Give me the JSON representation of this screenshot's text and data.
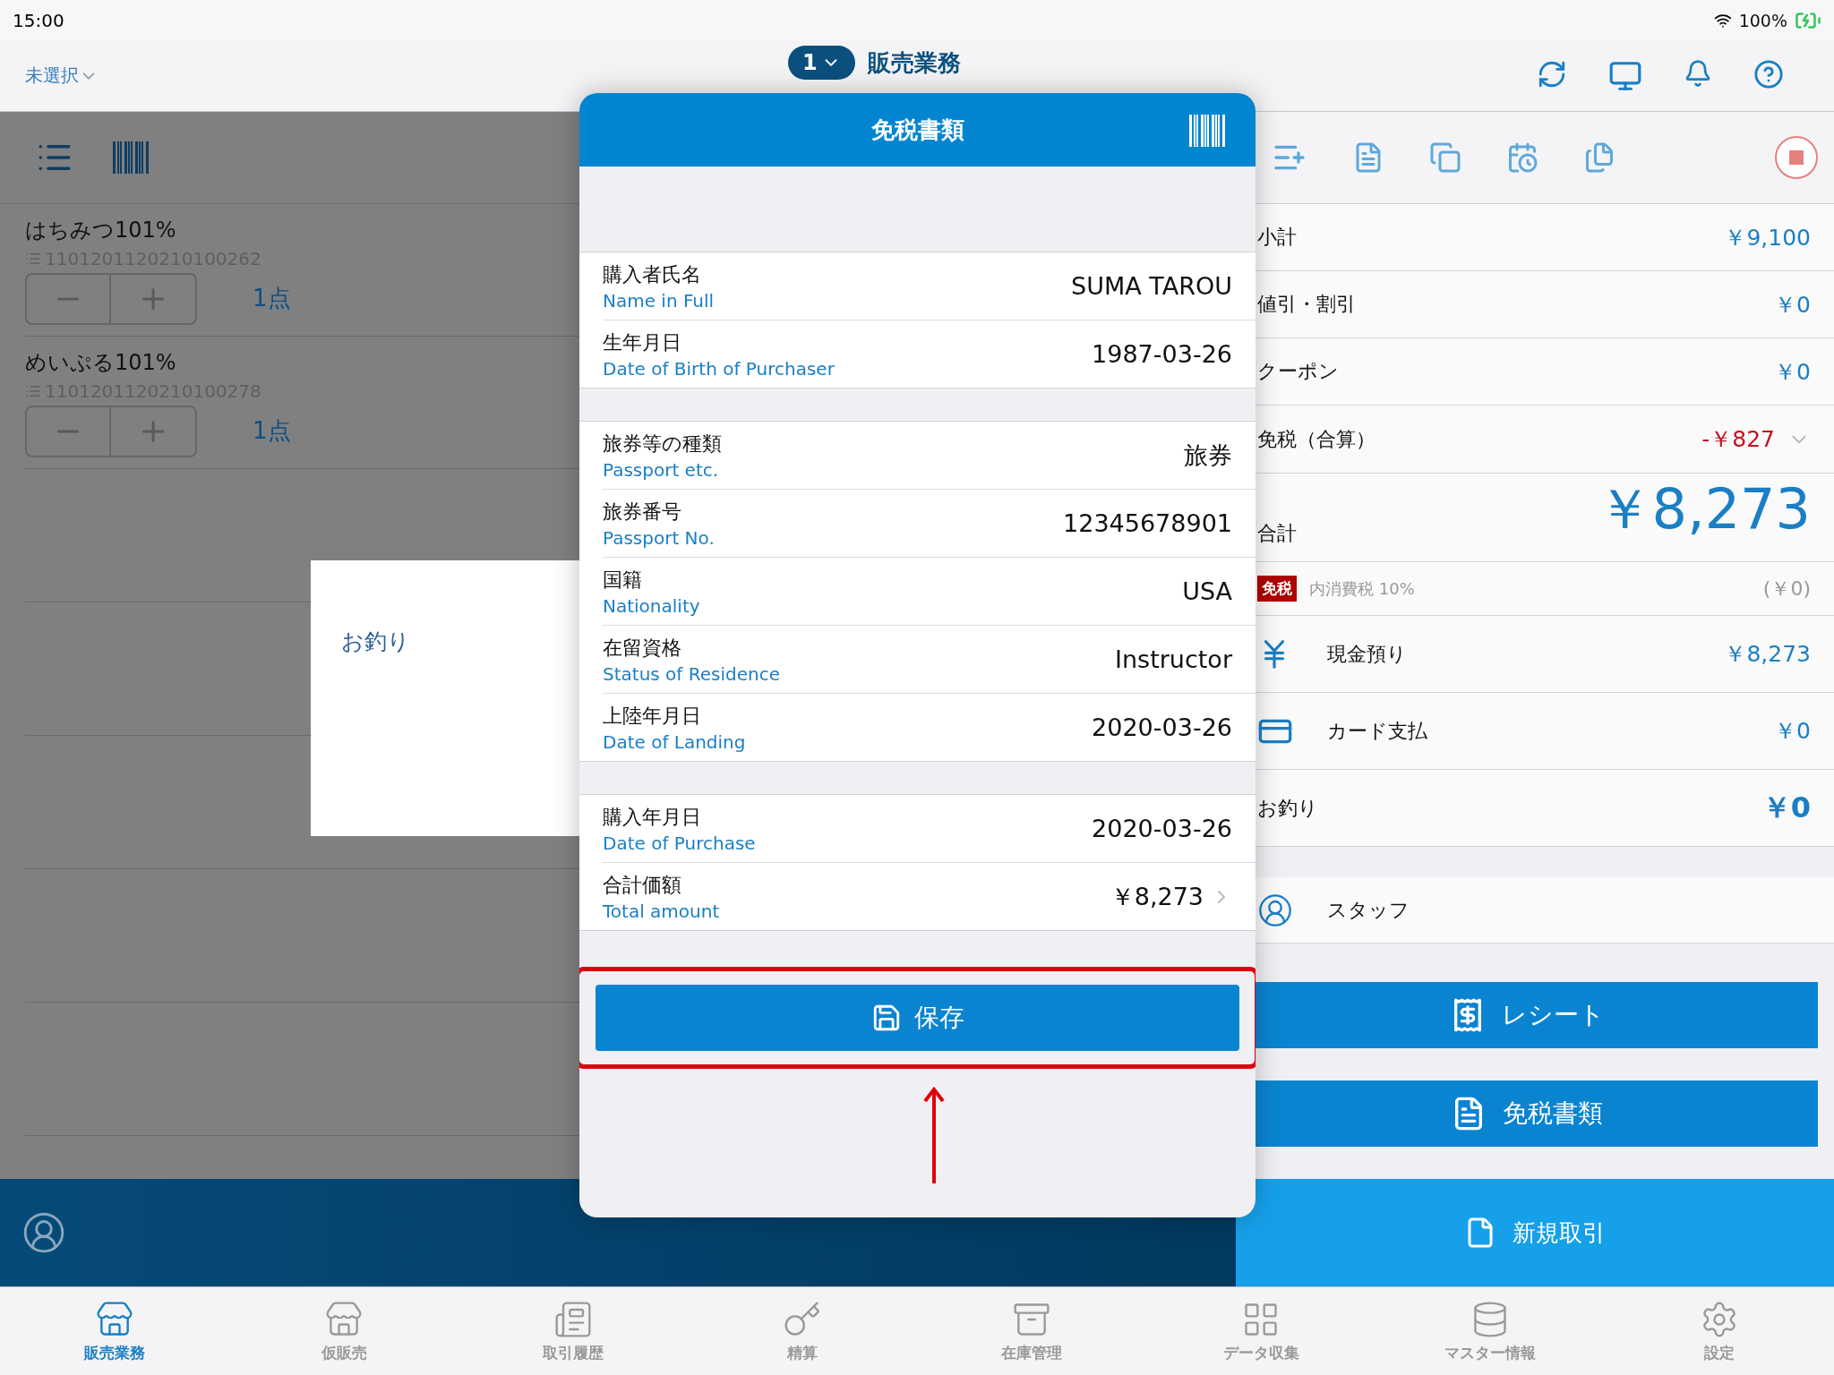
{
  "status_bar": {
    "time": "15:00",
    "battery": "100%"
  },
  "nav_bar": {
    "store": "未選択",
    "register": "1",
    "title": "販売業務"
  },
  "cart_items": [
    {
      "name": "はちみつ101%",
      "code": "1101201120210100262",
      "quantity": "1点"
    },
    {
      "name": "めいぷる101%",
      "code": "1101201120210100278",
      "quantity": "1点"
    }
  ],
  "change_popover": {
    "label": "お釣り"
  },
  "dialog": {
    "title": "免税書類",
    "sections": [
      [
        {
          "label": "購入者氏名",
          "label_en": "Name in Full",
          "value": "SUMA TAROU",
          "disclosure": false
        },
        {
          "label": "生年月日",
          "label_en": "Date of Birth of Purchaser",
          "value": "1987-03-26",
          "disclosure": false
        }
      ],
      [
        {
          "label": "旅券等の種類",
          "label_en": "Passport etc.",
          "value": "旅券",
          "disclosure": false
        },
        {
          "label": "旅券番号",
          "label_en": "Passport No.",
          "value": "12345678901",
          "disclosure": false
        },
        {
          "label": "国籍",
          "label_en": "Nationality",
          "value": "USA",
          "disclosure": false
        },
        {
          "label": "在留資格",
          "label_en": "Status of Residence",
          "value": "Instructor",
          "disclosure": false
        },
        {
          "label": "上陸年月日",
          "label_en": "Date of Landing",
          "value": "2020-03-26",
          "disclosure": false
        }
      ],
      [
        {
          "label": "購入年月日",
          "label_en": "Date of Purchase",
          "value": "2020-03-26",
          "disclosure": false
        },
        {
          "label": "合計価額",
          "label_en": "Total amount",
          "value": "￥8,273",
          "disclosure": true
        }
      ]
    ],
    "save_button": "保存"
  },
  "summary": [
    {
      "kind": "amount",
      "label": "小計",
      "value": "￥9,100"
    },
    {
      "kind": "amount",
      "label": "値引・割引",
      "value": "￥0"
    },
    {
      "kind": "amount",
      "label": "クーポン",
      "value": "￥0"
    },
    {
      "kind": "exemption",
      "label": "免税（合算）",
      "value": "-￥827"
    },
    {
      "kind": "total",
      "label": "合計",
      "value": "￥8,273"
    },
    {
      "kind": "tax",
      "badge": "免税",
      "label": "内消費税 10%",
      "value": "(￥0)"
    },
    {
      "kind": "cash",
      "label": "現金預り",
      "value": "￥8,273"
    },
    {
      "kind": "card",
      "label": "カード支払",
      "value": "￥0"
    },
    {
      "kind": "change",
      "label": "お釣り",
      "value": "￥0"
    }
  ],
  "staff": {
    "label": "スタッフ"
  },
  "action_buttons": [
    "レシート",
    "免税書類"
  ],
  "new_transaction": "新規取引",
  "tabs": [
    {
      "label": "販売業務",
      "selected": true
    },
    {
      "label": "仮販売",
      "selected": false
    },
    {
      "label": "取引履歴",
      "selected": false
    },
    {
      "label": "精算",
      "selected": false
    },
    {
      "label": "在庫管理",
      "selected": false
    },
    {
      "label": "データ収集",
      "selected": false
    },
    {
      "label": "マスター情報",
      "selected": false
    },
    {
      "label": "設定",
      "selected": false
    }
  ]
}
